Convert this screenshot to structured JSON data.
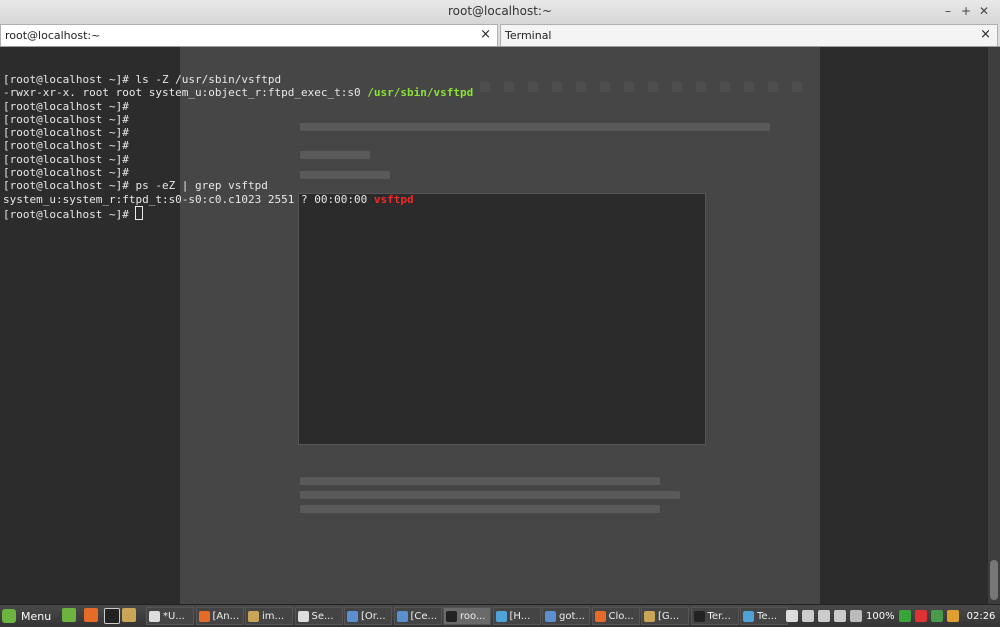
{
  "window": {
    "title": "root@localhost:~"
  },
  "tabs": [
    {
      "label": "root@localhost:~",
      "close": "×"
    },
    {
      "label": "Terminal",
      "close": "×"
    }
  ],
  "terminal": {
    "lines": [
      [
        {
          "t": "[root@localhost ~]# ls -Z /usr/sbin/vsftpd"
        }
      ],
      [
        {
          "t": "-rwxr-xr-x. root root system_u:object_r:ftpd_exec_t:s0 "
        },
        {
          "t": "/usr/sbin/vsftpd",
          "c": "green"
        }
      ],
      [
        {
          "t": "[root@localhost ~]#"
        }
      ],
      [
        {
          "t": "[root@localhost ~]#"
        }
      ],
      [
        {
          "t": "[root@localhost ~]#"
        }
      ],
      [
        {
          "t": "[root@localhost ~]#"
        }
      ],
      [
        {
          "t": "[root@localhost ~]#"
        }
      ],
      [
        {
          "t": "[root@localhost ~]#"
        }
      ],
      [
        {
          "t": "[root@localhost ~]# ps -eZ | grep vsftpd"
        }
      ],
      [
        {
          "t": "system_u:system_r:ftpd_t:s0-s0:c0.c1023 2551 ? 00:00:00 "
        },
        {
          "t": "vsftpd",
          "c": "red"
        }
      ],
      [
        {
          "t": "[root@localhost ~]# "
        },
        {
          "cursor": true
        }
      ]
    ]
  },
  "taskbar": {
    "menu_label": "Menu",
    "tasks": [
      {
        "label": "*U...",
        "icon": "document-icon"
      },
      {
        "label": "[An...",
        "icon": "firefox-icon"
      },
      {
        "label": "im...",
        "icon": "folder-icon"
      },
      {
        "label": "Se...",
        "icon": "document-icon"
      },
      {
        "label": "[Or...",
        "icon": "image-icon"
      },
      {
        "label": "[Ce...",
        "icon": "image-icon"
      },
      {
        "label": "roo...",
        "icon": "terminal-icon",
        "active": true
      },
      {
        "label": "[H...",
        "icon": "web-icon"
      },
      {
        "label": "got...",
        "icon": "image-icon"
      },
      {
        "label": "Clo...",
        "icon": "firefox-icon"
      },
      {
        "label": "[G...",
        "icon": "folder-icon"
      },
      {
        "label": "Ter...",
        "icon": "terminal-icon"
      },
      {
        "label": "Te...",
        "icon": "web-icon"
      }
    ],
    "battery": "100%",
    "clock": "02:26"
  },
  "colors": {
    "prompt_text": "#e8e8e8",
    "path_green": "#8ae234",
    "match_red": "#ef2929",
    "terminal_bg": "#2c2c2c"
  }
}
